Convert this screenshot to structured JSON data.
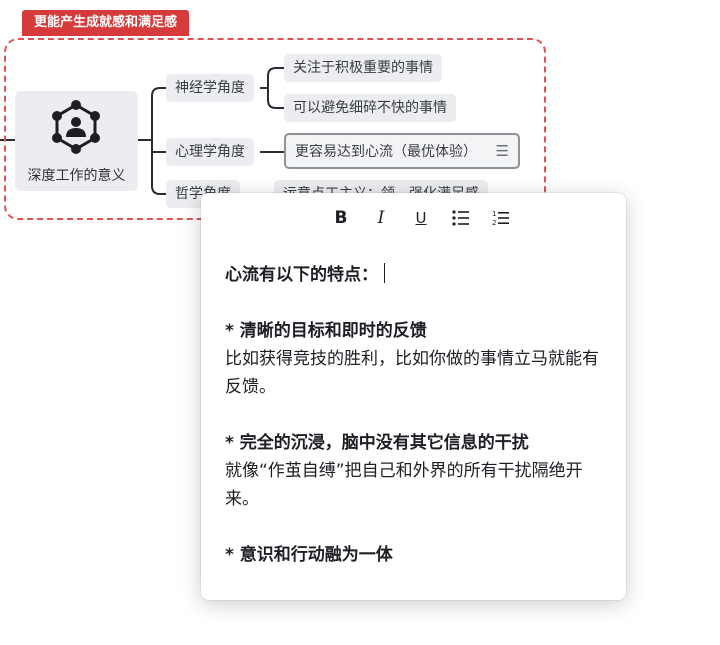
{
  "boundary": {
    "label": "更能产生成就感和满足感",
    "color": "#d63b3b"
  },
  "root": {
    "label": "深度工作的意义",
    "icon": "network-person-icon"
  },
  "branches": [
    {
      "label": "神经学角度",
      "children": [
        "关注于积极重要的事情",
        "可以避免细碎不快的事情"
      ]
    },
    {
      "label": "心理学角度",
      "children": [
        "更容易达到心流（最优体验）"
      ]
    },
    {
      "label": "哲学角度",
      "children": [
        "运意点工主义：领…强化满足感"
      ]
    }
  ],
  "toolbar": {
    "bold": "B",
    "italic": "I",
    "underline": "U",
    "bullet_icon": "bullet-list-icon",
    "number_icon": "numbered-list-icon"
  },
  "note": {
    "heading": "心流有以下的特点：",
    "p1_title": "* 清晰的目标和即时的反馈",
    "p1_body": "比如获得竞技的胜利，比如你做的事情立马就能有反馈。",
    "p2_title": "* 完全的沉浸，脑中没有其它信息的干扰",
    "p2_body": "就像“作茧自缚”把自己和外界的所有干扰隔绝开来。",
    "p3_title": "* 意识和行动融为一体"
  }
}
